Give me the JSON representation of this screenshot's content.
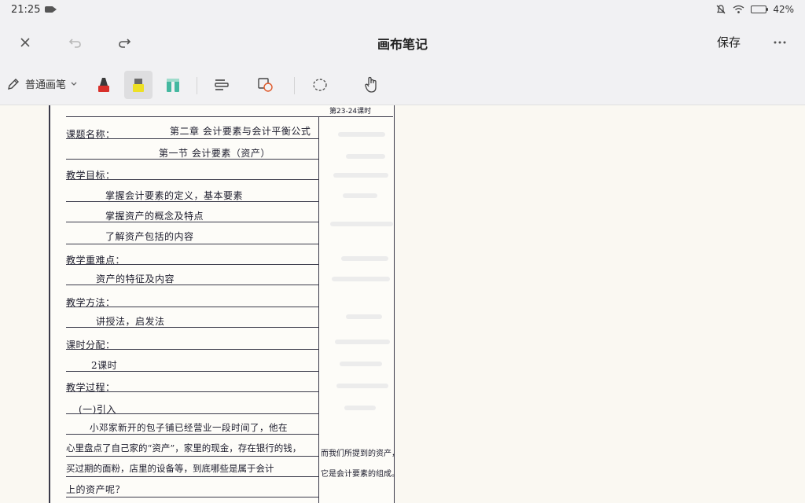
{
  "status_bar": {
    "time": "21:25",
    "battery_percent": "42%",
    "battery_level": 0.42
  },
  "header": {
    "title": "画布笔记",
    "save_label": "保存",
    "icons": [
      "close-icon",
      "undo-icon",
      "redo-icon",
      "more-icon"
    ]
  },
  "toolbar": {
    "pen_label": "普通画笔",
    "tools": [
      "red-marker-icon",
      "yellow-highlighter-icon",
      "teal-highlighter-icon",
      "text-format-icon",
      "shape-recognize-icon",
      "lasso-icon",
      "hand-icon"
    ],
    "active_tool": "yellow-highlighter-icon",
    "colors": {
      "red_marker": "#d8302a",
      "yellow_highlighter": "#ede025",
      "teal_highlighter": "#44b8a0"
    }
  },
  "note": {
    "top_note": "第23-24课时",
    "lines": [
      "课题名称：",
      "第二章 会计要素与会计平衡公式",
      "第一节 会计要素（资产）",
      "教学目标：",
      "掌握会计要素的定义，基本要素",
      "掌握资产的概念及特点",
      "了解资产包括的内容",
      "教学重难点：",
      "资产的特征及内容",
      "教学方法：",
      "讲授法，启发法",
      "课时分配：",
      "2课时",
      "教学过程：",
      "(一)引入",
      "小邓家新开的包子铺已经营业一段时间了，他在",
      "心里盘点了自己家的“资产”，家里的现金，存在银行的钱，",
      "买过期的面粉，店里的设备等，到底哪些是属于会计",
      "上的资产呢？"
    ],
    "margin_notes": [
      "而我们所提到的资产，",
      "它是会计要素的组成。"
    ]
  }
}
